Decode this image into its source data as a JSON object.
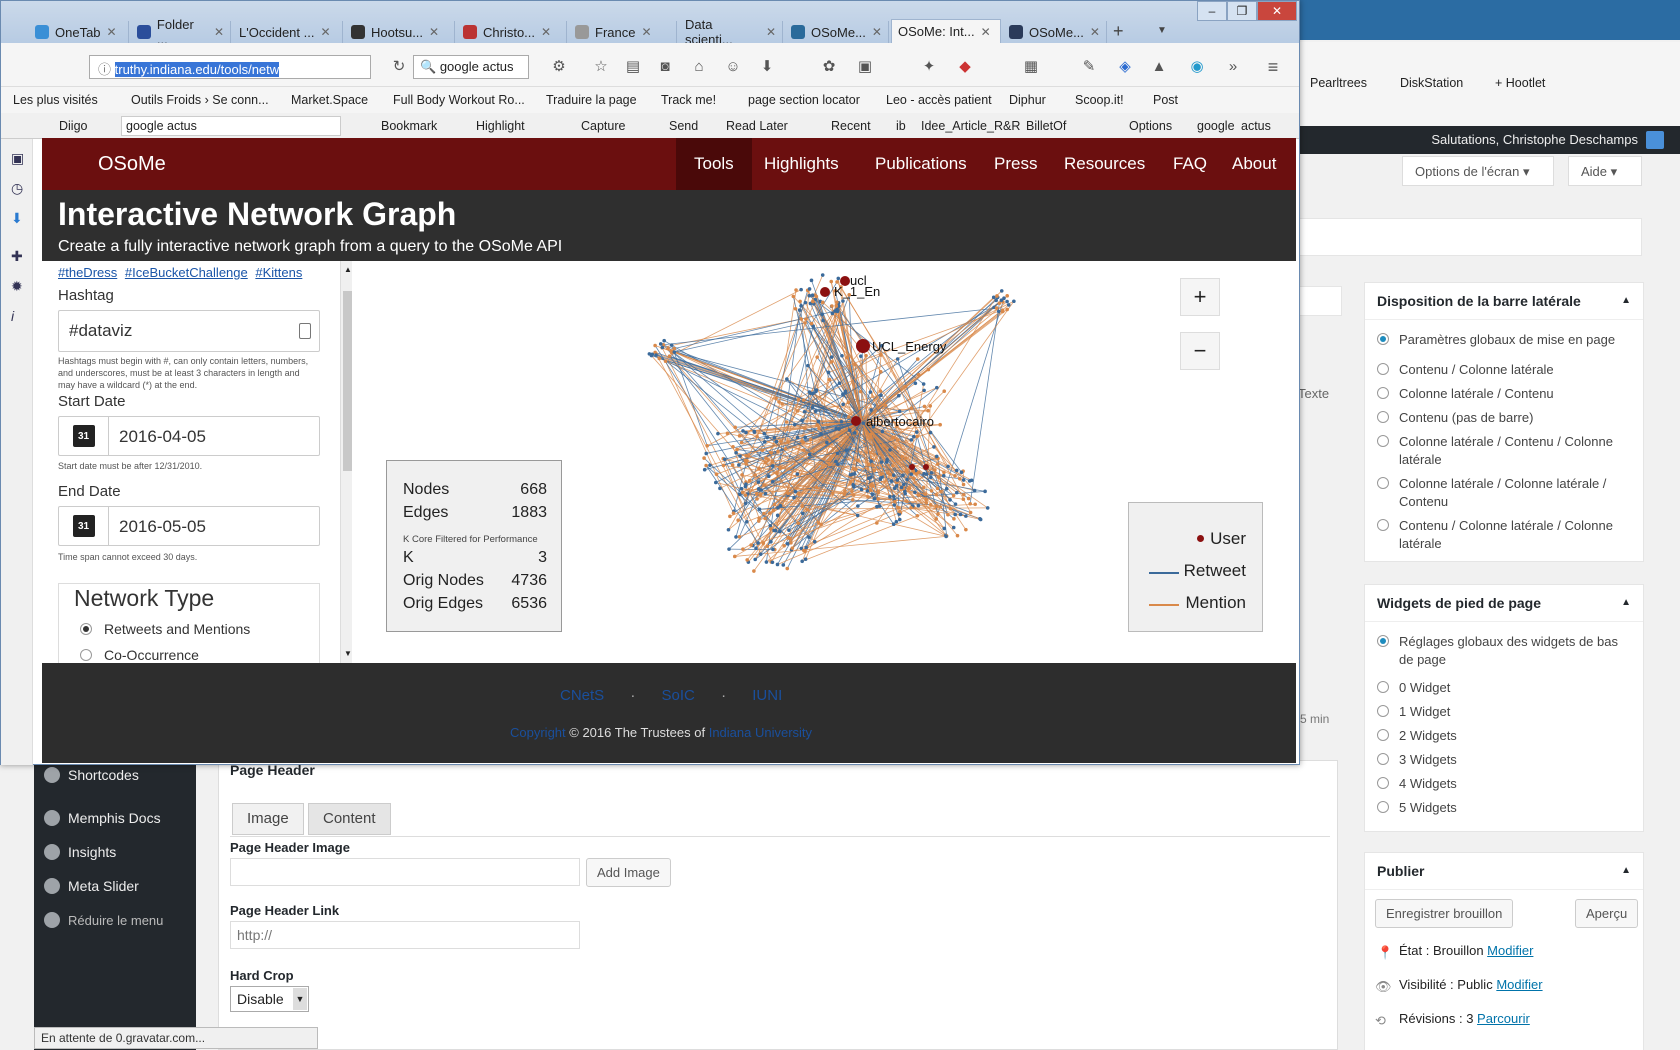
{
  "browser": {
    "tabs": [
      "OneTab",
      "Folder ...",
      "L'Occident ...",
      "Hootsu...",
      "Christo...",
      "France",
      "Data scienti...",
      "OSoMe...",
      "OSoMe: Int...",
      "OSoMe..."
    ],
    "url": "truthy.indiana.edu/tools/netw",
    "search": "google actus",
    "bookmarks": [
      "Les plus visités",
      "Outils Froids › Se conn...",
      "Market.Space",
      "Full Body Workout Ro...",
      "Traduire la page",
      "Track me!",
      "page section locator",
      "Leo - accès patient",
      "Diphur",
      "Scoop.it!",
      "Post"
    ],
    "toolbar2": {
      "diigo": "Diigo",
      "search": "google actus",
      "items": [
        "Bookmark",
        "Highlight",
        "Capture",
        "Send",
        "Read Later",
        "Recent",
        "ib",
        "Idee_Article_R&R",
        "BilletOf",
        "Options",
        "google",
        "actus"
      ]
    },
    "right_bookmarks": [
      "Pearltrees",
      "DiskStation",
      "+ Hootlet"
    ],
    "status": "En attente de 0.gravatar.com..."
  },
  "osome": {
    "brand": "OSoMe",
    "nav": [
      "Tools",
      "Highlights",
      "Publications",
      "Press",
      "Resources",
      "FAQ",
      "About"
    ],
    "title": "Interactive Network Graph",
    "subtitle": "Create a fully interactive network graph from a query to the OSoMe API",
    "examples": [
      "#theDress",
      "#IceBucketChallenge",
      "#Kittens"
    ],
    "hashtag_label": "Hashtag",
    "hashtag_value": "#dataviz",
    "hashtag_help": "Hashtags must begin with #, can only contain letters, numbers, and underscores, must be at least 3 characters in length and may have a wildcard (*) at the end.",
    "start_label": "Start Date",
    "start_value": "2016-04-05",
    "start_help": "Start date must be after 12/31/2010.",
    "end_label": "End Date",
    "end_value": "2016-05-05",
    "end_help": "Time span cannot exceed 30 days.",
    "network_type_label": "Network Type",
    "network_options": [
      "Retweets and Mentions",
      "Co-Occurrence"
    ],
    "stats": {
      "nodes_label": "Nodes",
      "nodes": "668",
      "edges_label": "Edges",
      "edges": "1883",
      "kcore_note": "K Core Filtered for Performance",
      "k_label": "K",
      "k": "3",
      "orig_nodes_label": "Orig Nodes",
      "orig_nodes": "4736",
      "orig_edges_label": "Orig Edges",
      "orig_edges": "6536"
    },
    "legend": {
      "user": "User",
      "retweet": "Retweet",
      "mention": "Mention"
    },
    "node_labels": [
      "ucl",
      "K_1_En",
      "UCL_Energy",
      "albertocairo"
    ],
    "zoom_in": "+",
    "zoom_out": "−",
    "footer_links": [
      "CNetS",
      "SoIC",
      "IUNI"
    ],
    "footer_copy_link": "Copyright",
    "footer_text": "© 2016 The Trustees of",
    "footer_univ": "Indiana University",
    "colors": {
      "nav": "#6b0f0f",
      "retweet": "#3b6a9a",
      "mention": "#d9894a",
      "user": "#8b1010"
    }
  },
  "wordpress": {
    "greeting": "Salutations, Christophe Deschamps",
    "screen_options": "Options de l'écran",
    "help": "Aide",
    "sidebar_items": [
      "Shortcodes",
      "Memphis Docs",
      "Insights",
      "Meta Slider",
      "Réduire le menu"
    ],
    "page_header_title": "Page Header",
    "tabs": [
      "Image",
      "Content"
    ],
    "ph_image_label": "Page Header Image",
    "add_image": "Add Image",
    "ph_link_label": "Page Header Link",
    "ph_link_value": "http://",
    "hard_crop_label": "Hard Crop",
    "hard_crop_value": "Disable",
    "texte_tab": "Texte",
    "min_label": "5 min",
    "sidebar_layout": {
      "title": "Disposition de la barre latérale",
      "options": [
        "Paramètres globaux de mise en page",
        "Contenu / Colonne latérale",
        "Colonne latérale / Contenu",
        "Contenu (pas de barre)",
        "Colonne latérale / Contenu / Colonne latérale",
        "Colonne latérale / Colonne latérale / Contenu",
        "Contenu / Colonne latérale / Colonne latérale"
      ]
    },
    "footer_widgets": {
      "title": "Widgets de pied de page",
      "options": [
        "Réglages globaux des widgets de bas de page",
        "0 Widget",
        "1 Widget",
        "2 Widgets",
        "3 Widgets",
        "4 Widgets",
        "5 Widgets"
      ]
    },
    "publish": {
      "title": "Publier",
      "draft": "Enregistrer brouillon",
      "preview": "Aperçu",
      "status": "État : Brouillon",
      "visibility": "Visibilité : Public",
      "revisions": "Révisions : 3",
      "modify": "Modifier",
      "browse": "Parcourir"
    }
  }
}
